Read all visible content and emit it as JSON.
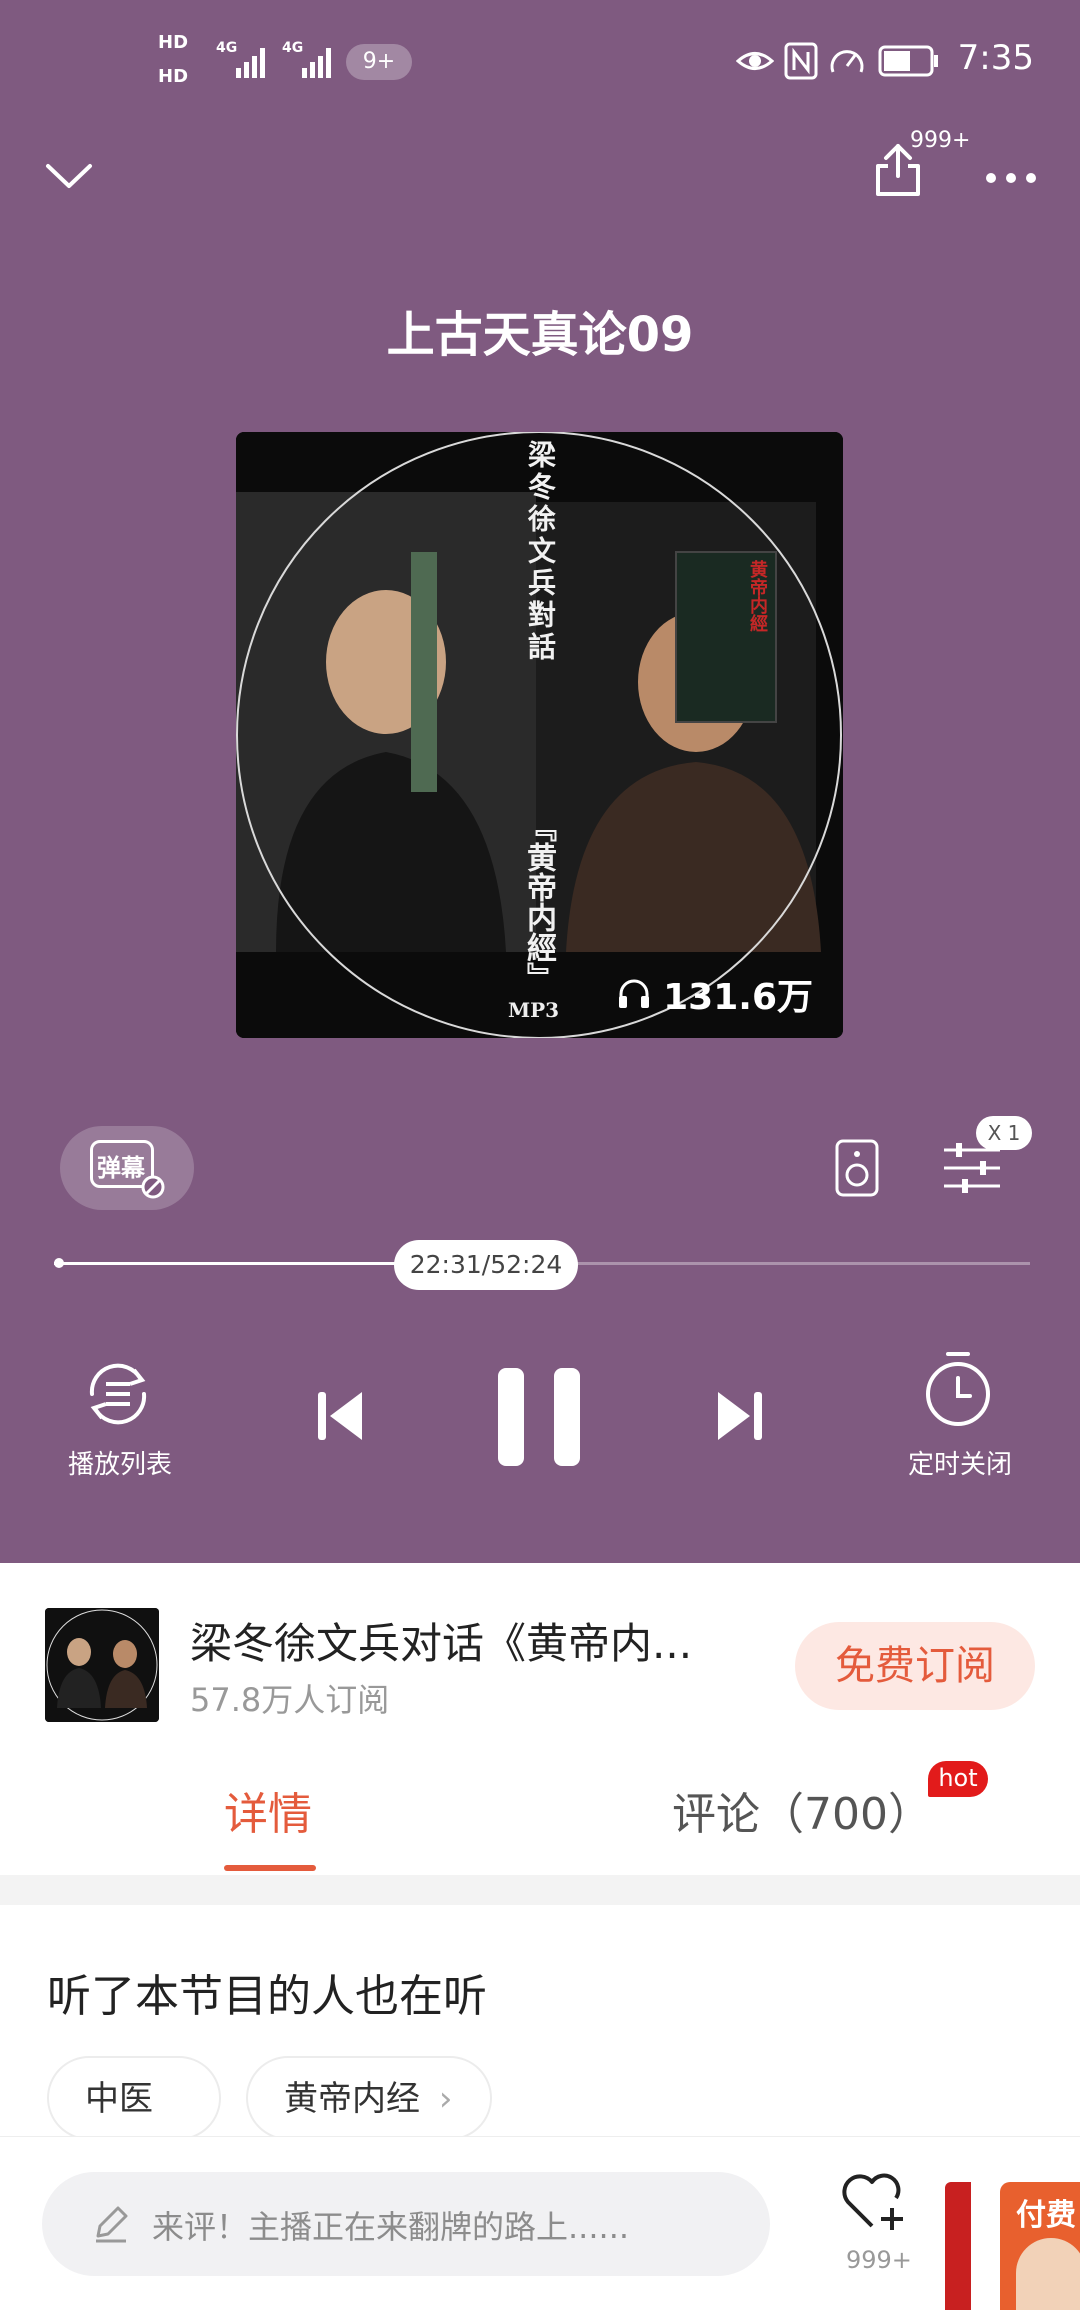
{
  "status_bar": {
    "hd1": "HD",
    "hd2": "HD",
    "net1": "4G",
    "net2": "4G",
    "notif_count": "9+",
    "time": "7:35"
  },
  "header": {
    "share_count": "999+"
  },
  "player": {
    "track_title": "上古天真论09",
    "play_count": "131.6万",
    "cover_text_1": "梁冬徐文兵對話",
    "cover_text_2": "『黄帝内經』",
    "cover_text_3": "MP3",
    "cover_text_4": "黄帝内經",
    "danmu_label": "弹幕",
    "speed": "X 1",
    "time_display": "22:31/52:24",
    "progress": 0.4295,
    "playlist_label": "播放列表",
    "timer_label": "定时关闭"
  },
  "album": {
    "title": "梁冬徐文兵对话《黄帝内...",
    "subscribers": "57.8万人订阅",
    "subscribe_label": "免费订阅"
  },
  "tabs": [
    {
      "label": "详情",
      "active": true
    },
    {
      "label": "评论（700）",
      "active": false
    }
  ],
  "tab_badge": "hot",
  "recommend": {
    "title": "听了本节目的人也在听",
    "chips": [
      "中医",
      "黄帝内经"
    ]
  },
  "bottom": {
    "comment_placeholder": "来评！主播正在来翻牌的路上......",
    "like_count": "999+",
    "ad_text": "付费"
  },
  "colors": {
    "player_bg": "#7f5a80",
    "accent": "#e45b3c",
    "hot_badge": "#e21b1b"
  }
}
